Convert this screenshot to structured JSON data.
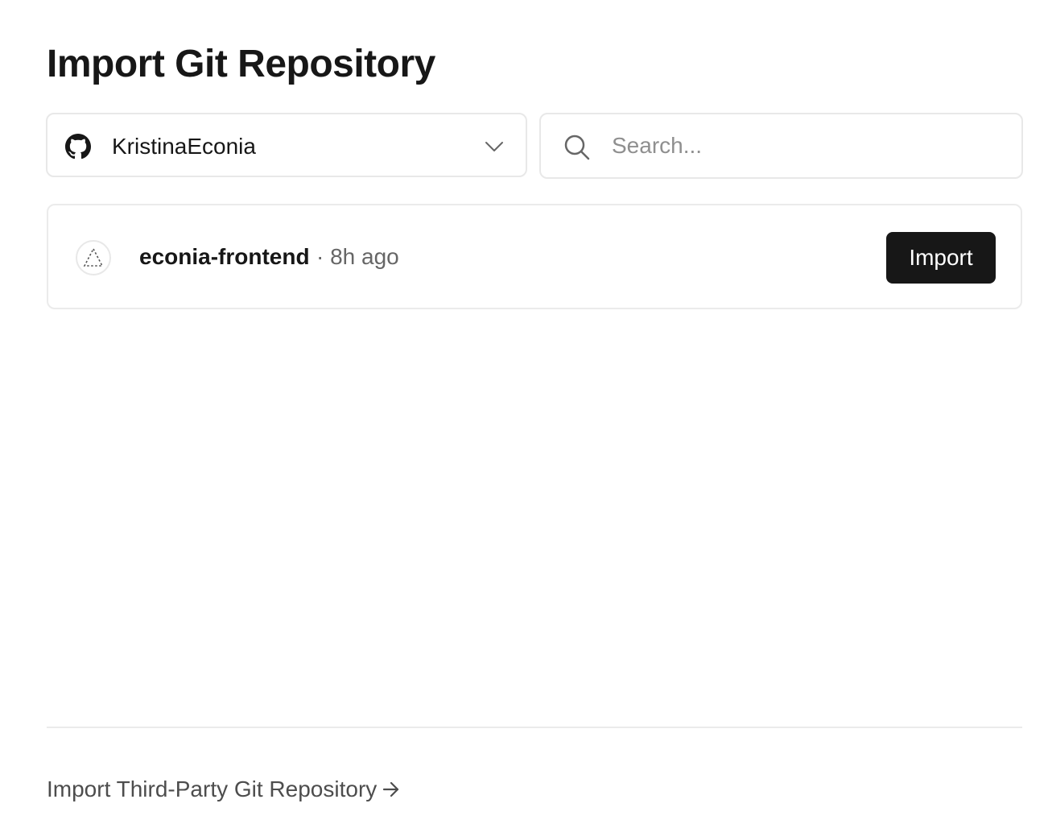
{
  "page": {
    "title": "Import Git Repository"
  },
  "account_selector": {
    "provider_icon": "github-icon",
    "selected_account": "KristinaEconia",
    "dropdown_icon": "chevron-down-icon"
  },
  "search": {
    "icon": "search-icon",
    "placeholder": "Search...",
    "value": ""
  },
  "repositories": [
    {
      "icon": "dashed-triangle-icon",
      "name": "econia-frontend",
      "updated": "· 8h ago",
      "action_label": "Import"
    }
  ],
  "footer": {
    "third_party_link": "Import Third-Party Git Repository",
    "link_icon": "arrow-right-icon"
  }
}
